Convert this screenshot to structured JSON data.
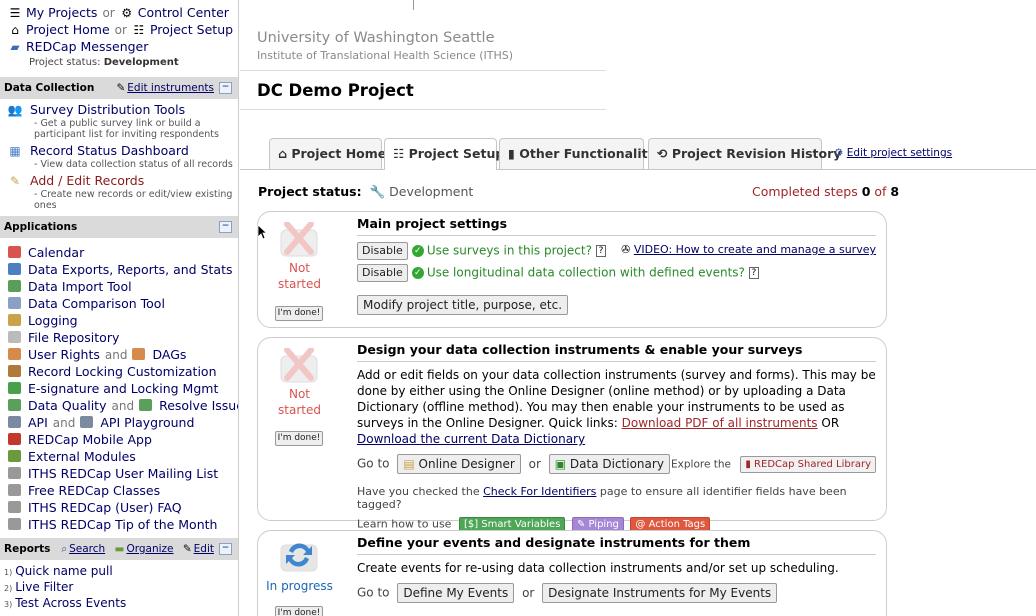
{
  "sidebar": {
    "nav": {
      "my_projects": "My Projects",
      "or": "or",
      "control_center": "Control Center",
      "project_home": "Project Home",
      "project_setup": "Project Setup",
      "messenger": "REDCap Messenger",
      "status_label": "Project status:",
      "status_value": "Development"
    },
    "data_collection": {
      "title": "Data Collection",
      "edit_instruments": "Edit instruments",
      "items": [
        {
          "label": "Survey Distribution Tools",
          "desc": "- Get a public survey link or build a participant list for inviting respondents"
        },
        {
          "label": "Record Status Dashboard",
          "desc": "- View data collection status of all records"
        },
        {
          "label": "Add / Edit Records",
          "desc": "- Create new records or edit/view existing ones"
        }
      ]
    },
    "applications": {
      "title": "Applications",
      "and": "and",
      "items": [
        {
          "label": "Calendar",
          "color": "#d9534f"
        },
        {
          "label": "Data Exports, Reports, and Stats",
          "color": "#4a7fc1"
        },
        {
          "label": "Data Import Tool",
          "color": "#5a9e5a"
        },
        {
          "label": "Data Comparison Tool",
          "color": "#8aa0c4"
        },
        {
          "label": "Logging",
          "color": "#c9a24a"
        },
        {
          "label": "File Repository",
          "color": "#bbbbbb"
        },
        {
          "label": "User Rights",
          "label2": "DAGs",
          "color": "#d88a4a"
        },
        {
          "label": "Record Locking Customization",
          "color": "#b07a3a"
        },
        {
          "label": "E-signature and Locking Mgmt",
          "color": "#4aa04a"
        },
        {
          "label": "Data Quality",
          "label2": "Resolve Issues",
          "color": "#5aa05a"
        },
        {
          "label": "API",
          "label2": "API Playground",
          "color": "#7a8aa0"
        },
        {
          "label": "REDCap Mobile App",
          "color": "#c0392b"
        },
        {
          "label": "External Modules",
          "color": "#6a9a3a"
        },
        {
          "label": "ITHS REDCap User Mailing List",
          "color": "#999999"
        },
        {
          "label": "Free REDCap Classes",
          "color": "#999999"
        },
        {
          "label": "ITHS REDCap (User) FAQ",
          "color": "#999999"
        },
        {
          "label": "ITHS REDCap Tip of the Month",
          "color": "#999999"
        }
      ]
    },
    "reports": {
      "title": "Reports",
      "search": "Search",
      "organize": "Organize",
      "edit": "Edit",
      "items": [
        {
          "num": "1)",
          "label": "Quick name pull"
        },
        {
          "num": "2)",
          "label": "Live Filter"
        },
        {
          "num": "3)",
          "label": "Test Across Events"
        }
      ]
    }
  },
  "main": {
    "institution": "University of Washington Seattle",
    "institute": "Institute of Translational Health Science (ITHS)",
    "project_title": "DC Demo Project",
    "tabs": [
      "Project Home",
      "Project Setup",
      "Other Functionality",
      "Project Revision History"
    ],
    "edit_settings": "Edit project settings",
    "project_status_label": "Project status:",
    "project_status_value": "Development",
    "steps_prefix": "Completed steps",
    "steps_done": "0",
    "steps_of": "of",
    "steps_total": "8",
    "status_not": "Not",
    "status_started": "started",
    "status_in_progress": "In progress",
    "done_button": "I'm done!",
    "card1": {
      "title": "Main project settings",
      "disable": "Disable",
      "opt1": "Use surveys in this project?",
      "opt2": "Use longitudinal data collection with defined events?",
      "video": "VIDEO: How to create and manage a survey",
      "modify": "Modify project title, purpose, etc."
    },
    "card2": {
      "title": "Design your data collection instruments & enable your surveys",
      "para": "Add or edit fields on your data collection instruments (survey and forms). This may be done by either using the Online Designer (online method) or by uploading a Data Dictionary (offline method). You may then enable your instruments to be used as surveys in the Online Designer.",
      "quick_links": "Quick links:",
      "pdf_link": "Download PDF of all instruments",
      "or_upper": "OR",
      "dict_link": "Download the current Data Dictionary",
      "go_to": "Go to",
      "online_designer": "Online Designer",
      "or": "or",
      "data_dictionary": "Data Dictionary",
      "explore": "Explore the",
      "shared_library": "REDCap Shared Library",
      "check_prefix": "Have you checked the",
      "check_link": "Check For Identifiers",
      "check_suffix": "page to ensure all identifier fields have been tagged?",
      "learn": "Learn how to use",
      "smart_vars": "Smart Variables",
      "piping": "Piping",
      "action_tags": "Action Tags"
    },
    "card3": {
      "title": "Define your events and designate instruments for them",
      "para": "Create events for re-using data collection instruments and/or set up scheduling.",
      "go_to": "Go to",
      "define_events": "Define My Events",
      "or": "or",
      "designate": "Designate Instruments for My Events"
    }
  },
  "colors": {
    "link": "#000066",
    "not_started": "#d9534f",
    "in_progress": "#1a66b3",
    "steps": "#a0262a",
    "section_header": "#dadada"
  }
}
